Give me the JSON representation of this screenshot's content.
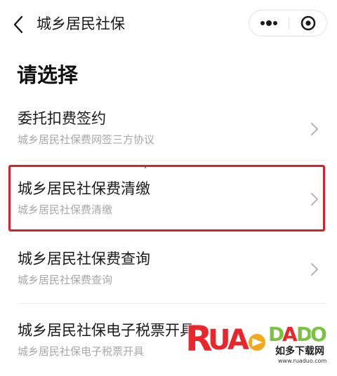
{
  "nav": {
    "title": "城乡居民社保",
    "back_icon": "chevron-left-icon",
    "more_icon": "more-dots-icon",
    "close_icon": "target-close-icon"
  },
  "heading": "请选择",
  "options": [
    {
      "title": "委托扣费签约",
      "subtitle": "城乡居民社保费网签三方协议"
    },
    {
      "title": "城乡居民社保费清缴",
      "subtitle": "城乡居民社保费清缴",
      "highlighted": true
    },
    {
      "title": "城乡居民社保费查询",
      "subtitle": "城乡居民社保费查询"
    },
    {
      "title": "城乡居民社保电子税票开具",
      "subtitle": "城乡居民社保电子税票开具"
    }
  ],
  "watermark": {
    "letters": "RUANDADO",
    "cn": "如多下载网",
    "url": "www.ruaduo.com"
  },
  "colors": {
    "highlight": "#d8202d",
    "text_primary": "#1a1a1a",
    "text_secondary": "#a8a8a8",
    "watermark_red": "#e8262b",
    "watermark_green": "#7cc242"
  }
}
